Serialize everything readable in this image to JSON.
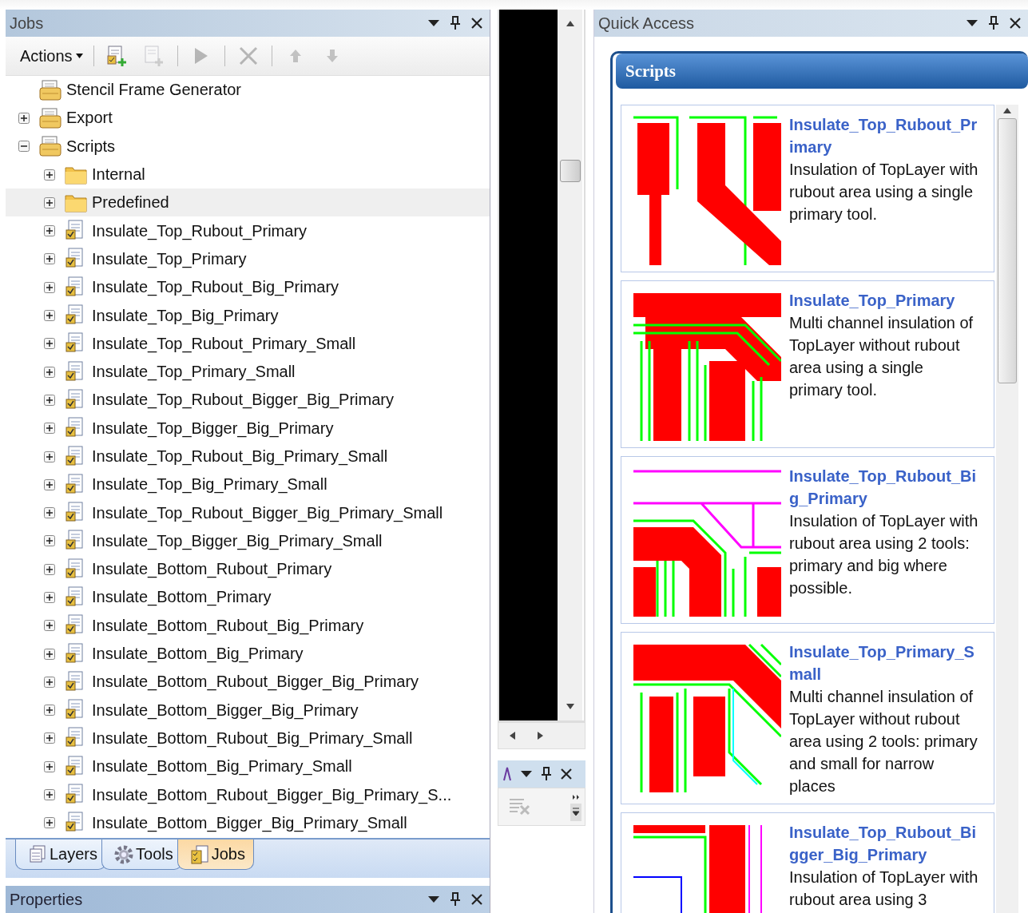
{
  "jobs_panel": {
    "title": "Jobs",
    "toolbar": {
      "actions_label": "Actions",
      "buttons": [
        {
          "kind": "add",
          "disabled": false
        },
        {
          "kind": "copy",
          "disabled": true
        },
        {
          "kind": "run",
          "disabled": true
        },
        {
          "kind": "delete",
          "disabled": true
        },
        {
          "kind": "up",
          "disabled": true
        },
        {
          "kind": "down",
          "disabled": true
        }
      ]
    },
    "tree": [
      {
        "label": "Stencil Frame Generator",
        "kind": "group",
        "selected": false
      },
      {
        "label": "Export",
        "kind": "group",
        "expanded": false,
        "selected": false
      },
      {
        "label": "Scripts",
        "kind": "group",
        "expanded": true,
        "selected": false,
        "children": [
          {
            "label": "Internal",
            "kind": "folder",
            "expanded": false,
            "selected": false
          },
          {
            "label": "Predefined",
            "kind": "folder",
            "expanded": false,
            "selected": true
          },
          {
            "label": "Insulate_Top_Rubout_Primary",
            "kind": "script",
            "expanded": false,
            "selected": false
          },
          {
            "label": "Insulate_Top_Primary",
            "kind": "script",
            "expanded": false,
            "selected": false
          },
          {
            "label": "Insulate_Top_Rubout_Big_Primary",
            "kind": "script",
            "expanded": false,
            "selected": false
          },
          {
            "label": "Insulate_Top_Big_Primary",
            "kind": "script",
            "expanded": false,
            "selected": false
          },
          {
            "label": "Insulate_Top_Rubout_Primary_Small",
            "kind": "script",
            "expanded": false,
            "selected": false
          },
          {
            "label": "Insulate_Top_Primary_Small",
            "kind": "script",
            "expanded": false,
            "selected": false
          },
          {
            "label": "Insulate_Top_Rubout_Bigger_Big_Primary",
            "kind": "script",
            "expanded": false,
            "selected": false
          },
          {
            "label": "Insulate_Top_Bigger_Big_Primary",
            "kind": "script",
            "expanded": false,
            "selected": false
          },
          {
            "label": "Insulate_Top_Rubout_Big_Primary_Small",
            "kind": "script",
            "expanded": false,
            "selected": false
          },
          {
            "label": "Insulate_Top_Big_Primary_Small",
            "kind": "script",
            "expanded": false,
            "selected": false
          },
          {
            "label": "Insulate_Top_Rubout_Bigger_Big_Primary_Small",
            "kind": "script",
            "expanded": false,
            "selected": false
          },
          {
            "label": "Insulate_Top_Bigger_Big_Primary_Small",
            "kind": "script",
            "expanded": false,
            "selected": false
          },
          {
            "label": "Insulate_Bottom_Rubout_Primary",
            "kind": "script",
            "expanded": false,
            "selected": false
          },
          {
            "label": "Insulate_Bottom_Primary",
            "kind": "script",
            "expanded": false,
            "selected": false
          },
          {
            "label": "Insulate_Bottom_Rubout_Big_Primary",
            "kind": "script",
            "expanded": false,
            "selected": false
          },
          {
            "label": "Insulate_Bottom_Big_Primary",
            "kind": "script",
            "expanded": false,
            "selected": false
          },
          {
            "label": "Insulate_Bottom_Rubout_Bigger_Big_Primary",
            "kind": "script",
            "expanded": false,
            "selected": false
          },
          {
            "label": "Insulate_Bottom_Bigger_Big_Primary",
            "kind": "script",
            "expanded": false,
            "selected": false
          },
          {
            "label": "Insulate_Bottom_Rubout_Big_Primary_Small",
            "kind": "script",
            "expanded": false,
            "selected": false
          },
          {
            "label": "Insulate_Bottom_Big_Primary_Small",
            "kind": "script",
            "expanded": false,
            "selected": false
          },
          {
            "label": "Insulate_Bottom_Rubout_Bigger_Big_Primary_S...",
            "kind": "script",
            "expanded": false,
            "selected": false
          },
          {
            "label": "Insulate_Bottom_Bigger_Big_Primary_Small",
            "kind": "script",
            "expanded": false,
            "selected": false
          }
        ]
      }
    ],
    "tabs": [
      {
        "label": "Layers",
        "kind": "layers",
        "selected": false
      },
      {
        "label": "Tools",
        "kind": "tools",
        "selected": false
      },
      {
        "label": "Jobs",
        "kind": "jobs",
        "selected": true
      }
    ]
  },
  "properties_panel": {
    "title": "Properties"
  },
  "quick_access": {
    "title": "Quick Access",
    "section_title": "Scripts",
    "cards": [
      {
        "name": "Insulate_Top_Rubout_Primary",
        "description": "Insulation of TopLayer with rubout area using a single primary tool."
      },
      {
        "name": "Insulate_Top_Primary",
        "description": "Multi channel insulation of TopLayer without rubout area using a single primary tool."
      },
      {
        "name": "Insulate_Top_Rubout_Big_Primary",
        "description": "Insulation of TopLayer with rubout area using 2 tools: primary and big where possible."
      },
      {
        "name": "Insulate_Top_Primary_Small",
        "description": "Multi channel insulation of TopLayer without rubout area using 2 tools: primary and small for narrow places"
      },
      {
        "name": "Insulate_Top_Rubout_Bigger_Big_Primary",
        "description": "Insulation of TopLayer with rubout area using 3"
      }
    ]
  }
}
